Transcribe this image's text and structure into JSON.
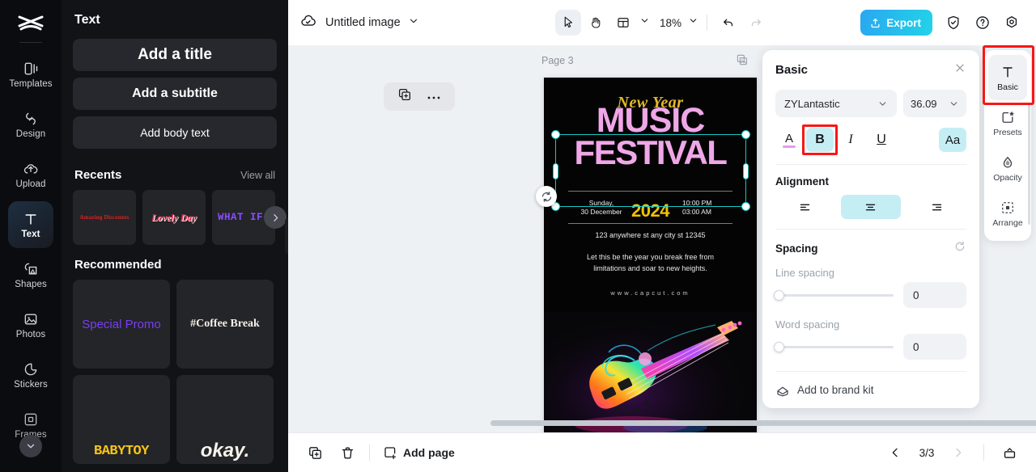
{
  "left_rail": {
    "logo_icon": "capcut-logo-icon",
    "items": [
      {
        "label": "Templates",
        "icon": "templates-icon",
        "active": false
      },
      {
        "label": "Design",
        "icon": "design-icon",
        "active": false
      },
      {
        "label": "Upload",
        "icon": "upload-cloud-icon",
        "active": false
      },
      {
        "label": "Text",
        "icon": "text-icon",
        "active": true
      },
      {
        "label": "Shapes",
        "icon": "shapes-icon",
        "active": false
      },
      {
        "label": "Photos",
        "icon": "photos-icon",
        "active": false
      },
      {
        "label": "Stickers",
        "icon": "stickers-icon",
        "active": false
      },
      {
        "label": "Frames",
        "icon": "frames-icon",
        "active": false
      }
    ],
    "scroll_down_icon": "chevron-down-icon"
  },
  "text_panel": {
    "title": "Text",
    "buttons": [
      {
        "label": "Add a title"
      },
      {
        "label": "Add a subtitle"
      },
      {
        "label": "Add body text"
      }
    ],
    "recents": {
      "heading": "Recents",
      "view_all": "View all",
      "next_icon": "chevron-right-icon",
      "items": [
        {
          "label": "Amazing Discounts"
        },
        {
          "label": "Lovely Day"
        },
        {
          "label": "WHAT IF."
        }
      ]
    },
    "recommended": {
      "heading": "Recommended",
      "items": [
        {
          "label": "Special Promo"
        },
        {
          "label": "#Coffee Break"
        },
        {
          "label": "BABYTOY"
        },
        {
          "label": "okay."
        }
      ]
    },
    "collapse_icon": "chevron-left-icon"
  },
  "topbar": {
    "cloud_icon": "cloud-saved-icon",
    "doc_name": "Untitled image",
    "doc_caret_icon": "chevron-down-icon",
    "tools": [
      {
        "name": "select",
        "icon": "cursor-arrow-icon",
        "selected": true
      },
      {
        "name": "hand",
        "icon": "hand-icon",
        "selected": false
      },
      {
        "name": "layout",
        "icon": "layout-icon",
        "selected": false
      }
    ],
    "layout_caret_icon": "chevron-down-icon",
    "zoom_level": "18%",
    "zoom_caret_icon": "chevron-down-icon",
    "undo_icon": "undo-icon",
    "redo_icon": "redo-icon",
    "export_label": "Export",
    "export_icon": "upload-icon",
    "export_color": "#22c6e8",
    "shield_icon": "shield-check-icon",
    "help_icon": "question-circle-icon",
    "settings_icon": "settings-gear-icon"
  },
  "canvas": {
    "page_label": "Page 3",
    "page_copy_icon": "duplicate-page-icon",
    "context_toolbar": {
      "duplicate_icon": "duplicate-icon",
      "more_icon": "more-horizontal-icon"
    },
    "rotate_icon": "rotate-icon",
    "poster": {
      "eyebrow": "New Year",
      "title_line1": "MUSIC",
      "title_line2": "FESTIVAL",
      "date_line1": "Sunday,",
      "date_line2": "30 December",
      "year": "2024",
      "time_line1": "10:00 PM",
      "time_line2": "03:00 AM",
      "address": "123 anywhere st any city st 12345",
      "body_line1": "Let this be the year you break free from",
      "body_line2": "limitations and soar to new heights.",
      "url": "www.capcut.com",
      "title_color": "#efa7e8",
      "accent_color": "#f2c200"
    }
  },
  "bottombar": {
    "duplicate_page_icon": "duplicate-page-icon",
    "delete_icon": "trash-icon",
    "add_page_label": "Add page",
    "add_page_icon": "add-page-icon",
    "prev_icon": "chevron-left-icon",
    "page_indicator": "3/3",
    "next_icon": "chevron-right-icon",
    "present_icon": "present-icon"
  },
  "properties": {
    "title": "Basic",
    "close_icon": "close-icon",
    "font_family": "ZYLantastic",
    "font_family_caret_icon": "chevron-down-icon",
    "font_size": "36.09",
    "font_size_caret_icon": "chevron-down-icon",
    "style_buttons": [
      {
        "name": "text-color",
        "label": "A",
        "active": false,
        "swatch": "#e79bef"
      },
      {
        "name": "bold",
        "label": "B",
        "active": true,
        "highlighted": true
      },
      {
        "name": "italic",
        "label": "I",
        "active": false
      },
      {
        "name": "underline",
        "label": "U",
        "active": false
      },
      {
        "name": "case",
        "label": "Aa",
        "active": true
      }
    ],
    "alignment_label": "Alignment",
    "alignments": [
      {
        "name": "align-left",
        "active": false
      },
      {
        "name": "align-center",
        "active": true
      },
      {
        "name": "align-right",
        "active": false
      }
    ],
    "spacing_label": "Spacing",
    "spacing_reset_icon": "reset-icon",
    "line_spacing_label": "Line spacing",
    "line_spacing_value": "0",
    "word_spacing_label": "Word spacing",
    "word_spacing_value": "0",
    "brand_kit_label": "Add to brand kit",
    "brand_kit_icon": "brand-kit-icon",
    "active_highlight_color": "#c4eef4",
    "annotation_color": "#fa1616"
  },
  "right_rail": {
    "items": [
      {
        "label": "Basic",
        "icon": "text-basic-icon",
        "active": true
      },
      {
        "label": "Presets",
        "icon": "presets-icon",
        "active": false
      },
      {
        "label": "Opacity",
        "icon": "opacity-icon",
        "active": false
      },
      {
        "label": "Arrange",
        "icon": "arrange-icon",
        "active": false
      }
    ]
  }
}
